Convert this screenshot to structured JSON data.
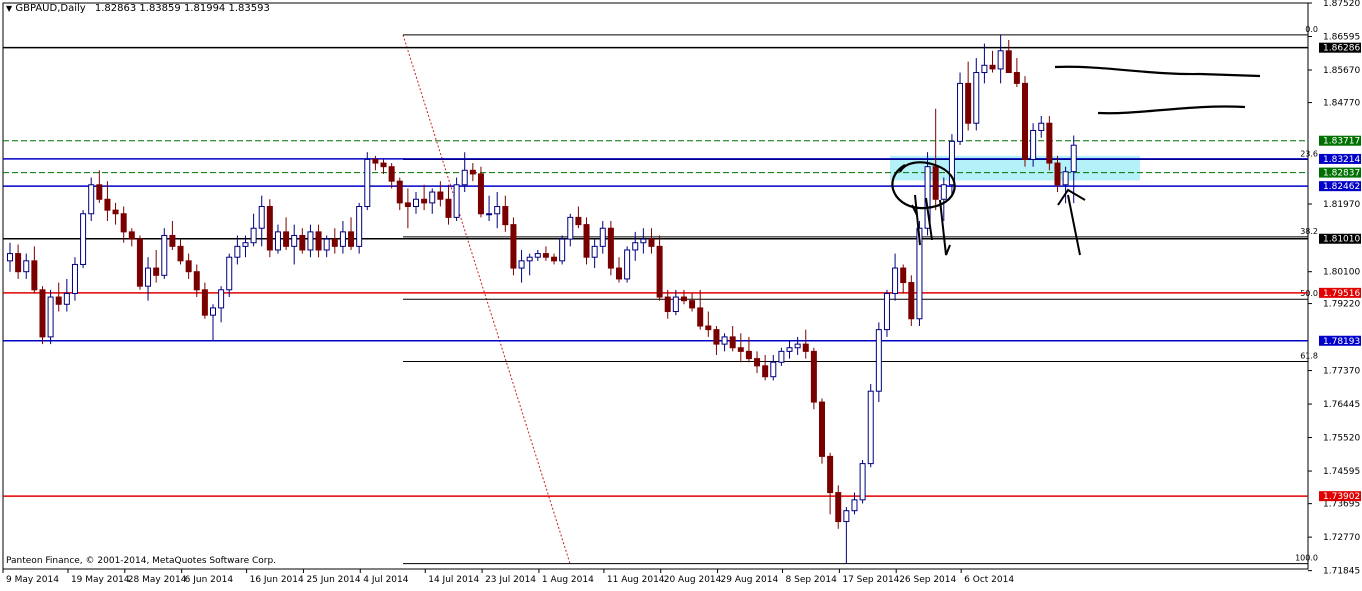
{
  "header": {
    "symbol_label": "GBPAUD,Daily",
    "ohlc_text": "1.82863 1.83859 1.81994 1.83593"
  },
  "copyright": "Panteon Finance, © 2001-2014, MetaQuotes Software Corp.",
  "colors": {
    "bull_body": "#ffffff",
    "bull_border": "#000080",
    "bear_body": "#7a0000",
    "wick_bull": "#000080",
    "wick_bear": "#7a0000",
    "black_level": "#000000",
    "blue_level": "#0000c8",
    "red_level": "#e00000",
    "green_level": "#007000",
    "zone": "#a8eef8",
    "fib_diag": "#cc2020"
  },
  "chart_data": {
    "type": "candlestick",
    "symbol": "GBPAUD",
    "timeframe": "Daily",
    "ylim": [
      1.7189,
      1.8752
    ],
    "grid": false,
    "y_ticks": [
      "1.87520",
      "1.86595",
      "1.85670",
      "1.84770",
      "1.81970",
      "1.80100",
      "1.79220",
      "1.77370",
      "1.76445",
      "1.75520",
      "1.74595",
      "1.73695",
      "1.72770",
      "1.71845"
    ],
    "x_tick_labels": [
      {
        "label": "9 May 2014",
        "index": 0
      },
      {
        "label": "19 May 2014",
        "index": 8
      },
      {
        "label": "28 May 2014",
        "index": 15
      },
      {
        "label": "6 Jun 2014",
        "index": 22
      },
      {
        "label": "16 Jun 2014",
        "index": 30
      },
      {
        "label": "25 Jun 2014",
        "index": 37
      },
      {
        "label": "4 Jul 2014",
        "index": 44
      },
      {
        "label": "14 Jul 2014",
        "index": 52
      },
      {
        "label": "23 Jul 2014",
        "index": 59
      },
      {
        "label": "1 Aug 2014",
        "index": 66
      },
      {
        "label": "11 Aug 2014",
        "index": 74
      },
      {
        "label": "20 Aug 2014",
        "index": 81
      },
      {
        "label": "29 Aug 2014",
        "index": 88
      },
      {
        "label": "8 Sep 2014",
        "index": 96
      },
      {
        "label": "17 Sep 2014",
        "index": 103
      },
      {
        "label": "26 Sep 2014",
        "index": 110
      },
      {
        "label": "6 Oct 2014",
        "index": 118
      }
    ],
    "levels": [
      {
        "value": 1.86286,
        "label": "1.86286",
        "color": "black",
        "kind": "solid"
      },
      {
        "value": 1.83717,
        "label": "1.83717",
        "color": "green",
        "kind": "dashed"
      },
      {
        "value": 1.83214,
        "label": "1.83214",
        "color": "blue",
        "kind": "solid"
      },
      {
        "value": 1.82837,
        "label": "1.82837",
        "color": "green",
        "kind": "dashed"
      },
      {
        "value": 1.82462,
        "label": "1.82462",
        "color": "blue",
        "kind": "solid"
      },
      {
        "value": 1.8101,
        "label": "1.81010",
        "color": "black",
        "kind": "solid"
      },
      {
        "value": 1.79516,
        "label": "1.79516",
        "color": "red",
        "kind": "solid"
      },
      {
        "value": 1.78193,
        "label": "1.78193",
        "color": "blue",
        "kind": "solid"
      },
      {
        "value": 1.73902,
        "label": "1.73902",
        "color": "red",
        "kind": "solid"
      }
    ],
    "fibonacci": {
      "high": 1.8664,
      "low": 1.7204,
      "levels": [
        {
          "label": "0.0",
          "value": 1.8664
        },
        {
          "label": "23.6",
          "value": 1.832
        },
        {
          "label": "38.2",
          "value": 1.8106
        },
        {
          "label": "50.0",
          "value": 1.7934
        },
        {
          "label": "61.8",
          "value": 1.7762
        },
        {
          "label": "100.0",
          "value": 1.7204
        }
      ]
    },
    "candles": [
      {
        "o": 1.804,
        "h": 1.809,
        "l": 1.801,
        "c": 1.806
      },
      {
        "o": 1.806,
        "h": 1.8085,
        "l": 1.799,
        "c": 1.801
      },
      {
        "o": 1.801,
        "h": 1.806,
        "l": 1.799,
        "c": 1.804
      },
      {
        "o": 1.804,
        "h": 1.808,
        "l": 1.795,
        "c": 1.796
      },
      {
        "o": 1.796,
        "h": 1.797,
        "l": 1.781,
        "c": 1.783
      },
      {
        "o": 1.783,
        "h": 1.796,
        "l": 1.781,
        "c": 1.794
      },
      {
        "o": 1.794,
        "h": 1.798,
        "l": 1.79,
        "c": 1.792
      },
      {
        "o": 1.792,
        "h": 1.799,
        "l": 1.79,
        "c": 1.795
      },
      {
        "o": 1.795,
        "h": 1.805,
        "l": 1.793,
        "c": 1.803
      },
      {
        "o": 1.803,
        "h": 1.818,
        "l": 1.802,
        "c": 1.817
      },
      {
        "o": 1.817,
        "h": 1.827,
        "l": 1.815,
        "c": 1.825
      },
      {
        "o": 1.825,
        "h": 1.829,
        "l": 1.82,
        "c": 1.821
      },
      {
        "o": 1.821,
        "h": 1.826,
        "l": 1.815,
        "c": 1.818
      },
      {
        "o": 1.818,
        "h": 1.82,
        "l": 1.814,
        "c": 1.817
      },
      {
        "o": 1.817,
        "h": 1.819,
        "l": 1.809,
        "c": 1.812
      },
      {
        "o": 1.812,
        "h": 1.813,
        "l": 1.808,
        "c": 1.81
      },
      {
        "o": 1.81,
        "h": 1.811,
        "l": 1.796,
        "c": 1.797
      },
      {
        "o": 1.797,
        "h": 1.805,
        "l": 1.793,
        "c": 1.802
      },
      {
        "o": 1.802,
        "h": 1.807,
        "l": 1.798,
        "c": 1.8
      },
      {
        "o": 1.8,
        "h": 1.813,
        "l": 1.799,
        "c": 1.811
      },
      {
        "o": 1.811,
        "h": 1.815,
        "l": 1.807,
        "c": 1.808
      },
      {
        "o": 1.808,
        "h": 1.81,
        "l": 1.803,
        "c": 1.804
      },
      {
        "o": 1.804,
        "h": 1.806,
        "l": 1.799,
        "c": 1.801
      },
      {
        "o": 1.801,
        "h": 1.803,
        "l": 1.794,
        "c": 1.796
      },
      {
        "o": 1.796,
        "h": 1.798,
        "l": 1.788,
        "c": 1.789
      },
      {
        "o": 1.789,
        "h": 1.792,
        "l": 1.782,
        "c": 1.791
      },
      {
        "o": 1.791,
        "h": 1.797,
        "l": 1.787,
        "c": 1.796
      },
      {
        "o": 1.796,
        "h": 1.806,
        "l": 1.794,
        "c": 1.805
      },
      {
        "o": 1.805,
        "h": 1.811,
        "l": 1.803,
        "c": 1.808
      },
      {
        "o": 1.808,
        "h": 1.811,
        "l": 1.805,
        "c": 1.809
      },
      {
        "o": 1.809,
        "h": 1.817,
        "l": 1.808,
        "c": 1.813
      },
      {
        "o": 1.813,
        "h": 1.822,
        "l": 1.808,
        "c": 1.819
      },
      {
        "o": 1.819,
        "h": 1.821,
        "l": 1.805,
        "c": 1.807
      },
      {
        "o": 1.807,
        "h": 1.814,
        "l": 1.806,
        "c": 1.812
      },
      {
        "o": 1.812,
        "h": 1.816,
        "l": 1.807,
        "c": 1.808
      },
      {
        "o": 1.808,
        "h": 1.814,
        "l": 1.803,
        "c": 1.811
      },
      {
        "o": 1.811,
        "h": 1.813,
        "l": 1.806,
        "c": 1.807
      },
      {
        "o": 1.807,
        "h": 1.814,
        "l": 1.805,
        "c": 1.812
      },
      {
        "o": 1.812,
        "h": 1.814,
        "l": 1.805,
        "c": 1.807
      },
      {
        "o": 1.807,
        "h": 1.811,
        "l": 1.805,
        "c": 1.81
      },
      {
        "o": 1.81,
        "h": 1.813,
        "l": 1.806,
        "c": 1.808
      },
      {
        "o": 1.808,
        "h": 1.815,
        "l": 1.806,
        "c": 1.812
      },
      {
        "o": 1.812,
        "h": 1.816,
        "l": 1.807,
        "c": 1.808
      },
      {
        "o": 1.808,
        "h": 1.82,
        "l": 1.806,
        "c": 1.819
      },
      {
        "o": 1.819,
        "h": 1.834,
        "l": 1.818,
        "c": 1.832
      },
      {
        "o": 1.832,
        "h": 1.833,
        "l": 1.829,
        "c": 1.831
      },
      {
        "o": 1.831,
        "h": 1.832,
        "l": 1.828,
        "c": 1.83
      },
      {
        "o": 1.83,
        "h": 1.831,
        "l": 1.824,
        "c": 1.826
      },
      {
        "o": 1.826,
        "h": 1.827,
        "l": 1.818,
        "c": 1.82
      },
      {
        "o": 1.82,
        "h": 1.824,
        "l": 1.813,
        "c": 1.819
      },
      {
        "o": 1.819,
        "h": 1.823,
        "l": 1.817,
        "c": 1.821
      },
      {
        "o": 1.821,
        "h": 1.825,
        "l": 1.818,
        "c": 1.82
      },
      {
        "o": 1.82,
        "h": 1.824,
        "l": 1.817,
        "c": 1.823
      },
      {
        "o": 1.823,
        "h": 1.826,
        "l": 1.819,
        "c": 1.821
      },
      {
        "o": 1.821,
        "h": 1.825,
        "l": 1.814,
        "c": 1.816
      },
      {
        "o": 1.816,
        "h": 1.827,
        "l": 1.815,
        "c": 1.825
      },
      {
        "o": 1.825,
        "h": 1.834,
        "l": 1.823,
        "c": 1.829
      },
      {
        "o": 1.829,
        "h": 1.831,
        "l": 1.826,
        "c": 1.828
      },
      {
        "o": 1.828,
        "h": 1.83,
        "l": 1.816,
        "c": 1.817
      },
      {
        "o": 1.817,
        "h": 1.822,
        "l": 1.815,
        "c": 1.817
      },
      {
        "o": 1.817,
        "h": 1.823,
        "l": 1.813,
        "c": 1.819
      },
      {
        "o": 1.819,
        "h": 1.822,
        "l": 1.812,
        "c": 1.814
      },
      {
        "o": 1.814,
        "h": 1.816,
        "l": 1.8,
        "c": 1.802
      },
      {
        "o": 1.802,
        "h": 1.807,
        "l": 1.798,
        "c": 1.804
      },
      {
        "o": 1.804,
        "h": 1.806,
        "l": 1.8,
        "c": 1.805
      },
      {
        "o": 1.805,
        "h": 1.807,
        "l": 1.804,
        "c": 1.806
      },
      {
        "o": 1.806,
        "h": 1.808,
        "l": 1.804,
        "c": 1.805
      },
      {
        "o": 1.805,
        "h": 1.806,
        "l": 1.803,
        "c": 1.804
      },
      {
        "o": 1.804,
        "h": 1.811,
        "l": 1.803,
        "c": 1.81
      },
      {
        "o": 1.81,
        "h": 1.817,
        "l": 1.808,
        "c": 1.816
      },
      {
        "o": 1.816,
        "h": 1.819,
        "l": 1.813,
        "c": 1.814
      },
      {
        "o": 1.814,
        "h": 1.816,
        "l": 1.803,
        "c": 1.805
      },
      {
        "o": 1.805,
        "h": 1.81,
        "l": 1.802,
        "c": 1.808
      },
      {
        "o": 1.808,
        "h": 1.815,
        "l": 1.806,
        "c": 1.813
      },
      {
        "o": 1.813,
        "h": 1.815,
        "l": 1.8,
        "c": 1.802
      },
      {
        "o": 1.802,
        "h": 1.805,
        "l": 1.798,
        "c": 1.799
      },
      {
        "o": 1.799,
        "h": 1.808,
        "l": 1.798,
        "c": 1.807
      },
      {
        "o": 1.807,
        "h": 1.812,
        "l": 1.804,
        "c": 1.809
      },
      {
        "o": 1.809,
        "h": 1.813,
        "l": 1.806,
        "c": 1.81
      },
      {
        "o": 1.81,
        "h": 1.813,
        "l": 1.806,
        "c": 1.808
      },
      {
        "o": 1.808,
        "h": 1.811,
        "l": 1.793,
        "c": 1.794
      },
      {
        "o": 1.794,
        "h": 1.796,
        "l": 1.788,
        "c": 1.79
      },
      {
        "o": 1.79,
        "h": 1.796,
        "l": 1.789,
        "c": 1.794
      },
      {
        "o": 1.794,
        "h": 1.796,
        "l": 1.792,
        "c": 1.793
      },
      {
        "o": 1.793,
        "h": 1.795,
        "l": 1.79,
        "c": 1.791
      },
      {
        "o": 1.791,
        "h": 1.796,
        "l": 1.785,
        "c": 1.786
      },
      {
        "o": 1.786,
        "h": 1.79,
        "l": 1.783,
        "c": 1.785
      },
      {
        "o": 1.785,
        "h": 1.786,
        "l": 1.778,
        "c": 1.781
      },
      {
        "o": 1.781,
        "h": 1.784,
        "l": 1.779,
        "c": 1.783
      },
      {
        "o": 1.783,
        "h": 1.786,
        "l": 1.779,
        "c": 1.78
      },
      {
        "o": 1.78,
        "h": 1.784,
        "l": 1.776,
        "c": 1.779
      },
      {
        "o": 1.779,
        "h": 1.783,
        "l": 1.776,
        "c": 1.777
      },
      {
        "o": 1.777,
        "h": 1.779,
        "l": 1.773,
        "c": 1.775
      },
      {
        "o": 1.775,
        "h": 1.778,
        "l": 1.771,
        "c": 1.772
      },
      {
        "o": 1.772,
        "h": 1.778,
        "l": 1.771,
        "c": 1.776
      },
      {
        "o": 1.776,
        "h": 1.78,
        "l": 1.775,
        "c": 1.779
      },
      {
        "o": 1.779,
        "h": 1.782,
        "l": 1.777,
        "c": 1.78
      },
      {
        "o": 1.78,
        "h": 1.783,
        "l": 1.778,
        "c": 1.781
      },
      {
        "o": 1.781,
        "h": 1.785,
        "l": 1.777,
        "c": 1.779
      },
      {
        "o": 1.779,
        "h": 1.78,
        "l": 1.763,
        "c": 1.765
      },
      {
        "o": 1.765,
        "h": 1.766,
        "l": 1.748,
        "c": 1.75
      },
      {
        "o": 1.75,
        "h": 1.751,
        "l": 1.734,
        "c": 1.74
      },
      {
        "o": 1.74,
        "h": 1.742,
        "l": 1.73,
        "c": 1.732
      },
      {
        "o": 1.732,
        "h": 1.736,
        "l": 1.7204,
        "c": 1.735
      },
      {
        "o": 1.735,
        "h": 1.74,
        "l": 1.734,
        "c": 1.738
      },
      {
        "o": 1.738,
        "h": 1.749,
        "l": 1.737,
        "c": 1.748
      },
      {
        "o": 1.748,
        "h": 1.77,
        "l": 1.747,
        "c": 1.768
      },
      {
        "o": 1.768,
        "h": 1.787,
        "l": 1.765,
        "c": 1.785
      },
      {
        "o": 1.785,
        "h": 1.796,
        "l": 1.783,
        "c": 1.795
      },
      {
        "o": 1.795,
        "h": 1.806,
        "l": 1.793,
        "c": 1.802
      },
      {
        "o": 1.802,
        "h": 1.803,
        "l": 1.795,
        "c": 1.798
      },
      {
        "o": 1.798,
        "h": 1.8,
        "l": 1.786,
        "c": 1.788
      },
      {
        "o": 1.788,
        "h": 1.815,
        "l": 1.786,
        "c": 1.813
      },
      {
        "o": 1.813,
        "h": 1.834,
        "l": 1.811,
        "c": 1.83
      },
      {
        "o": 1.83,
        "h": 1.846,
        "l": 1.818,
        "c": 1.821
      },
      {
        "o": 1.821,
        "h": 1.827,
        "l": 1.815,
        "c": 1.825
      },
      {
        "o": 1.825,
        "h": 1.839,
        "l": 1.822,
        "c": 1.837
      },
      {
        "o": 1.837,
        "h": 1.856,
        "l": 1.836,
        "c": 1.853
      },
      {
        "o": 1.853,
        "h": 1.859,
        "l": 1.84,
        "c": 1.842
      },
      {
        "o": 1.842,
        "h": 1.86,
        "l": 1.84,
        "c": 1.856
      },
      {
        "o": 1.856,
        "h": 1.864,
        "l": 1.853,
        "c": 1.858
      },
      {
        "o": 1.858,
        "h": 1.862,
        "l": 1.856,
        "c": 1.857
      },
      {
        "o": 1.857,
        "h": 1.8664,
        "l": 1.853,
        "c": 1.862
      },
      {
        "o": 1.862,
        "h": 1.865,
        "l": 1.856,
        "c": 1.856
      },
      {
        "o": 1.856,
        "h": 1.86,
        "l": 1.852,
        "c": 1.853
      },
      {
        "o": 1.853,
        "h": 1.855,
        "l": 1.83,
        "c": 1.832
      },
      {
        "o": 1.832,
        "h": 1.842,
        "l": 1.83,
        "c": 1.84
      },
      {
        "o": 1.84,
        "h": 1.844,
        "l": 1.838,
        "c": 1.842
      },
      {
        "o": 1.842,
        "h": 1.844,
        "l": 1.829,
        "c": 1.831
      },
      {
        "o": 1.831,
        "h": 1.833,
        "l": 1.823,
        "c": 1.825
      },
      {
        "o": 1.825,
        "h": 1.83,
        "l": 1.8199,
        "c": 1.8286
      },
      {
        "o": 1.82863,
        "h": 1.83859,
        "l": 1.81994,
        "c": 1.83593
      }
    ],
    "annotations": [
      {
        "type": "rectangle",
        "label": "support-zone"
      },
      {
        "type": "hand-drawn",
        "label": "circle"
      },
      {
        "type": "hand-drawn",
        "label": "arrow-down"
      },
      {
        "type": "hand-drawn",
        "label": "arrow-up"
      },
      {
        "type": "hand-drawn",
        "label": "projection-lines"
      }
    ]
  }
}
